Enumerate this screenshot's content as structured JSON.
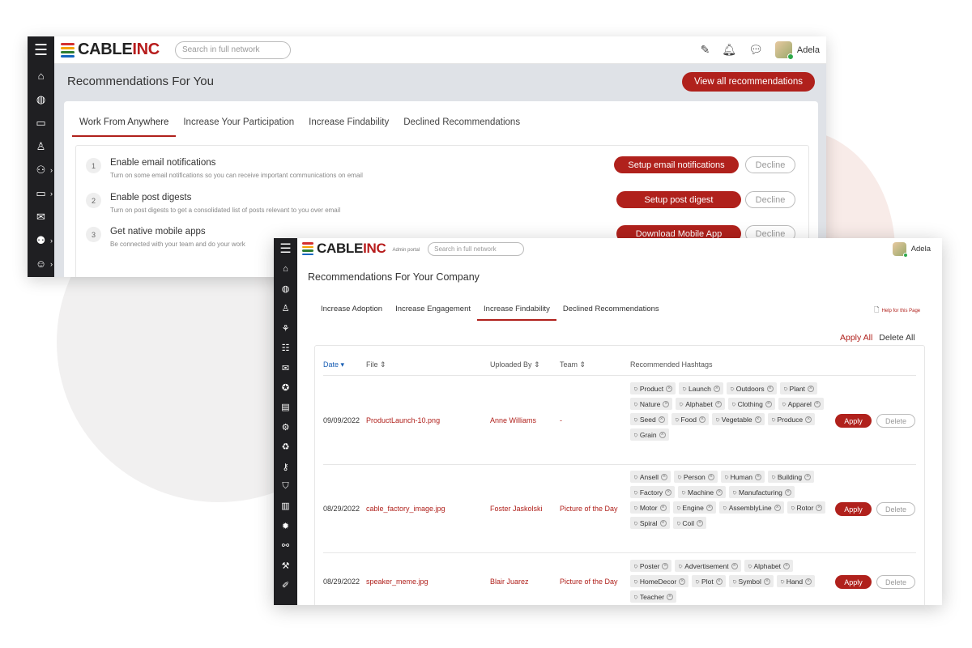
{
  "brand": {
    "name_main": "CABLE",
    "name_accent": "INC",
    "stripe_colors": [
      "#d32f2f",
      "#f4a100",
      "#2e7d32",
      "#1565c0"
    ]
  },
  "window1": {
    "search_placeholder": "Search in full network",
    "user_name": "Adela",
    "title": "Recommendations For You",
    "view_all_label": "View all recommendations",
    "tabs": [
      "Work From Anywhere",
      "Increase Your Participation",
      "Increase Findability",
      "Declined Recommendations"
    ],
    "items": [
      {
        "num": "1",
        "title": "Enable email notifications",
        "desc": "Turn on some email notifications so you can receive important communications on email",
        "action": "Setup email notifications",
        "decline": "Decline"
      },
      {
        "num": "2",
        "title": "Enable post digests",
        "desc": "Turn on post digests to get a consolidated list of posts relevant to you over email",
        "action": "Setup post digest",
        "decline": "Decline"
      },
      {
        "num": "3",
        "title": "Get native mobile apps",
        "desc": "Be connected with your team and do your work",
        "action": "Download Mobile App",
        "decline": "Decline"
      }
    ]
  },
  "window2": {
    "admin_label": "Admin portal",
    "search_placeholder": "Search in full network",
    "user_name": "Adela",
    "title": "Recommendations For Your Company",
    "tabs": [
      "Increase Adoption",
      "Increase Engagement",
      "Increase Findability",
      "Declined Recommendations"
    ],
    "help_label": "Help for this Page",
    "apply_all": "Apply All",
    "delete_all": "Delete All",
    "columns": {
      "date": "Date",
      "file": "File",
      "uploaded_by": "Uploaded By",
      "team": "Team",
      "hashtags": "Recommended Hashtags"
    },
    "apply_label": "Apply",
    "delete_label": "Delete",
    "rows": [
      {
        "date": "09/09/2022",
        "file": "ProductLaunch-10.png",
        "uploaded_by": "Anne Williams",
        "team": "-",
        "tags": [
          "Product",
          "Launch",
          "Outdoors",
          "Plant",
          "Nature",
          "Alphabet",
          "Clothing",
          "Apparel",
          "Seed",
          "Food",
          "Vegetable",
          "Produce",
          "Grain"
        ]
      },
      {
        "date": "08/29/2022",
        "file": "cable_factory_image.jpg",
        "uploaded_by": "Foster Jaskolski",
        "team": "Picture of the Day",
        "tags": [
          "Ansell",
          "Person",
          "Human",
          "Building",
          "Factory",
          "Machine",
          "Manufacturing",
          "Motor",
          "Engine",
          "AssemblyLine",
          "Rotor",
          "Spiral",
          "Coil"
        ]
      },
      {
        "date": "08/29/2022",
        "file": "speaker_meme.jpg",
        "uploaded_by": "Blair Juarez",
        "team": "Picture of the Day",
        "tags": [
          "Poster",
          "Advertisement",
          "Alphabet",
          "HomeDecor",
          "Plot",
          "Symbol",
          "Hand",
          "Teacher"
        ]
      }
    ]
  }
}
